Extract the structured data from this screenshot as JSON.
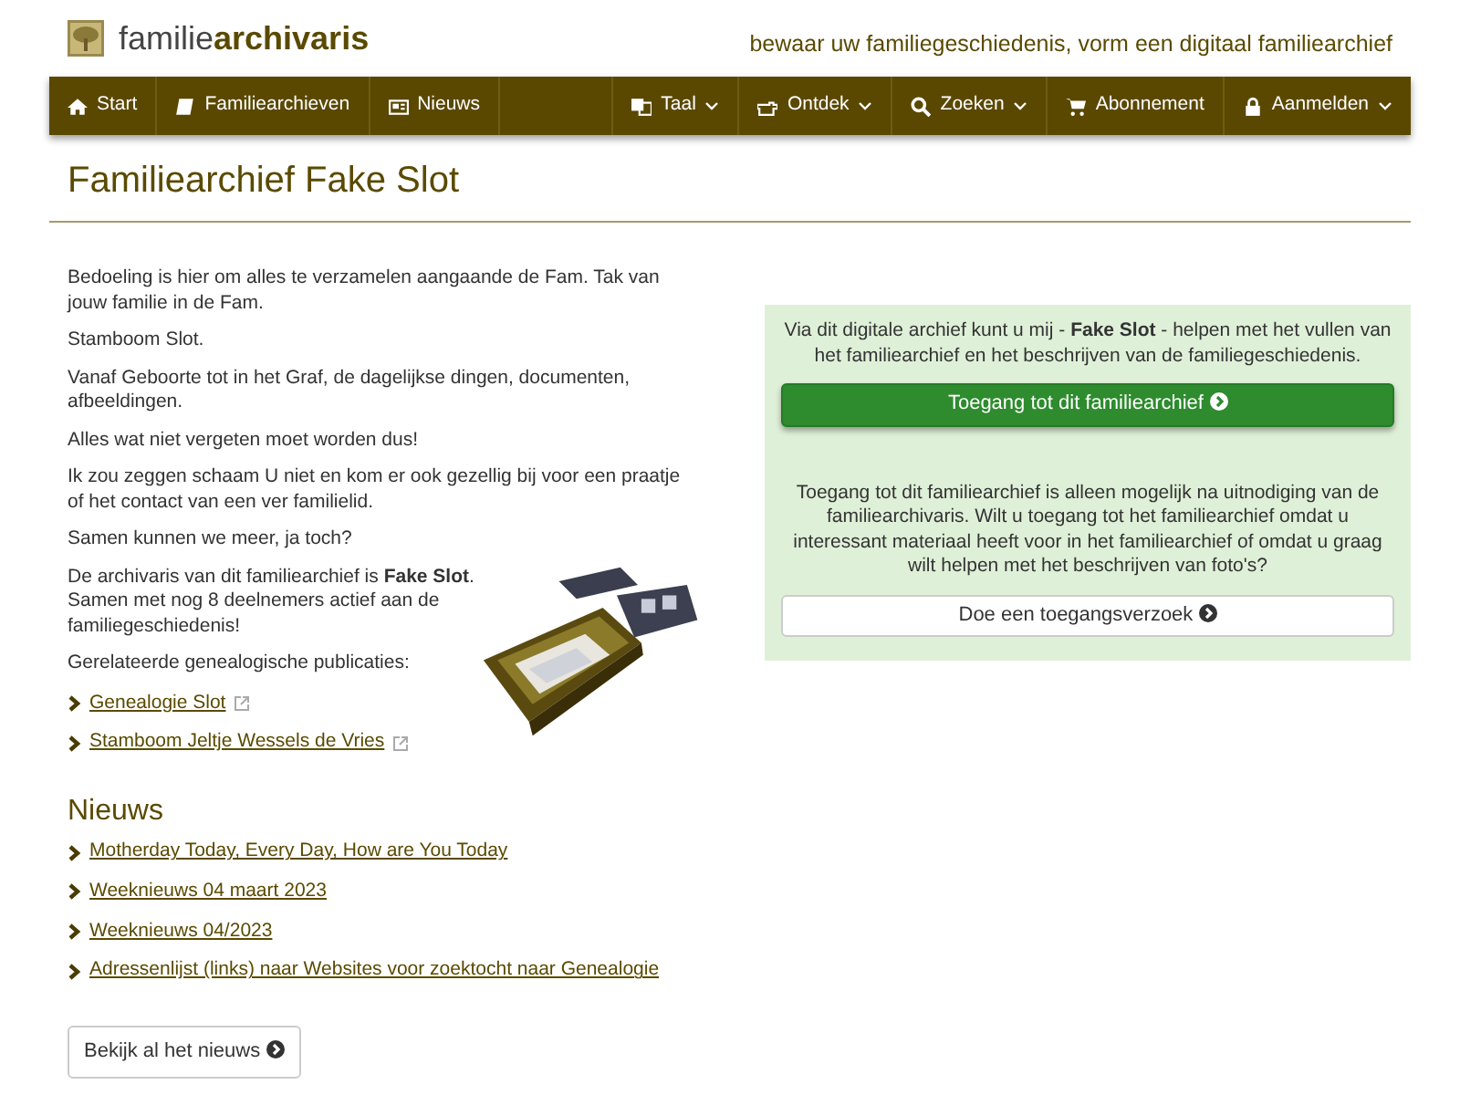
{
  "brand": {
    "light": "familie",
    "bold": "archivaris"
  },
  "tagline": "bewaar uw familiegeschiedenis, vorm een digitaal familiearchief",
  "nav_left": [
    {
      "label": "Start",
      "dropdown": false
    },
    {
      "label": "Familiearchieven",
      "dropdown": false
    },
    {
      "label": "Nieuws",
      "dropdown": false
    }
  ],
  "nav_right": [
    {
      "label": "Taal",
      "dropdown": true
    },
    {
      "label": "Ontdek",
      "dropdown": true
    },
    {
      "label": "Zoeken",
      "dropdown": true
    },
    {
      "label": "Abonnement",
      "dropdown": false
    },
    {
      "label": "Aanmelden",
      "dropdown": true
    }
  ],
  "page_title": "Familiearchief Fake Slot",
  "intro": [
    "Bedoeling is hier om alles te verzamelen aangaande de Fam. Tak van jouw familie in de Fam.",
    "Stamboom Slot.",
    "Vanaf Geboorte tot in het Graf, de dagelijkse dingen, documenten, afbeeldingen.",
    "Alles wat niet vergeten moet worden dus!",
    "Ik zou zeggen schaam U niet en kom er ook gezellig bij voor een praatje of het contact van een ver familielid.",
    "Samen kunnen we meer, ja toch?"
  ],
  "archivist_text": "De archivaris van dit familiearchief is **Fake Slot**. Samen met nog 8 deelnemers actief aan de familiegeschiedenis!",
  "publications_label": "Gerelateerde genealogische publicaties:",
  "publications": [
    "Genealogie Slot",
    "Stamboom Jeltje Wessels de Vries"
  ],
  "news": {
    "title": "Nieuws",
    "items": [
      "Motherday Today, Every Day, How are You Today",
      "Weeknieuws 04 maart 2023",
      "Weeknieuws 04/2023",
      "Adressenlijst (links) naar Websites voor zoektocht naar Genealogie"
    ],
    "button": "Bekijk al het nieuws"
  },
  "access": {
    "intro": "Via dit digitale archief kunt u mij - **Fake Slot** - helpen met het vullen van het familiearchief en het beschrijven van de familiegeschiedenis.",
    "button": "Toegang tot dit familiearchief",
    "note": "Toegang tot dit familiearchief is alleen mogelijk na uitnodiging van de familiearchivaris. Wilt u toegang tot het familiearchief omdat u interessant materiaal heeft voor in het familiearchief of omdat u graag wilt helpen met het beschrijven van foto's?",
    "request_button": "Doe een toegangsverzoek"
  }
}
